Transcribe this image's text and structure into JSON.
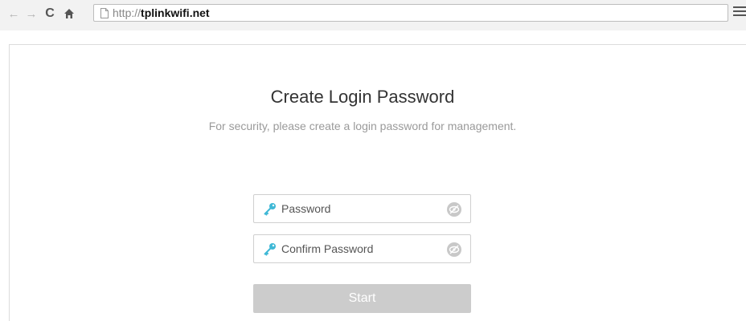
{
  "browser": {
    "url_scheme": "http://",
    "url_host": "tplinkwifi.net",
    "icons": {
      "back": "back-arrow-icon",
      "forward": "forward-arrow-icon",
      "reload": "reload-icon",
      "home": "home-icon",
      "page": "page-icon",
      "menu": "hamburger-menu-icon"
    }
  },
  "page": {
    "title": "Create Login Password",
    "subtitle": "For security, please create a login password for management.",
    "password_field": {
      "placeholder": "Password",
      "value": ""
    },
    "confirm_field": {
      "placeholder": "Confirm Password",
      "value": ""
    },
    "start_label": "Start",
    "colors": {
      "accent_key": "#3fb8d6",
      "button_disabled": "#cccccc",
      "eye_icon": "#c8c8c8"
    }
  }
}
